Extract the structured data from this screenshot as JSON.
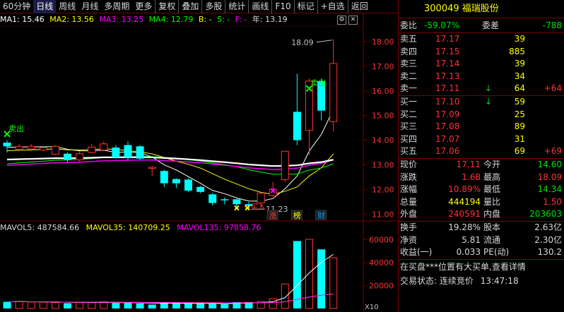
{
  "toolbar": {
    "periods": [
      "60分钟",
      "日线",
      "周线",
      "月线",
      "多周期",
      "更多"
    ],
    "active_period": "日线",
    "actions": [
      "复权",
      "叠加",
      "多股",
      "统计",
      "画线",
      "F10",
      "标记",
      "+自选",
      "返回"
    ]
  },
  "ma_legend": {
    "ma1": "MA1: 15.46",
    "ma2": "MA2: 13.56",
    "ma3": "MA3: 13.25",
    "ma4": "MA4: 12.79",
    "b": "B: -",
    "s": "S: -",
    "f": "F: -",
    "year": "年: 13.19"
  },
  "colors": {
    "up": "#ff3232",
    "down": "#00ffff",
    "ma1": "#ffffff",
    "ma2": "#ffff00",
    "ma3": "#ff00ff",
    "ma4": "#00ff00",
    "grid": "#7a0000",
    "panel_red": "#ff3232",
    "panel_green": "#00e000",
    "panel_yellow": "#ffff00"
  },
  "chart_data": {
    "type": "candlestick",
    "y_axis_labels": [
      "18.00",
      "17.00",
      "16.00",
      "15.00",
      "14.00",
      "13.00",
      "12.00",
      "11.00"
    ],
    "ylim": [
      10.75,
      18.6
    ],
    "annotations": {
      "high": "18.09",
      "low": "11.23",
      "sell_label": "卖出",
      "buy_label": "买入",
      "badges": [
        "涨",
        "榜",
        "财"
      ]
    },
    "candles": [
      {
        "o": 13.9,
        "c": 13.75,
        "h": 14.0,
        "l": 13.5
      },
      {
        "o": 13.62,
        "c": 13.74,
        "h": 13.85,
        "l": 13.55
      },
      {
        "o": 13.64,
        "c": 13.75,
        "h": 13.85,
        "l": 13.55
      },
      {
        "o": 13.6,
        "c": 13.7,
        "h": 13.78,
        "l": 13.55
      },
      {
        "o": 13.43,
        "c": 13.75,
        "h": 13.8,
        "l": 13.4
      },
      {
        "o": 13.45,
        "c": 13.2,
        "h": 13.5,
        "l": 13.1
      },
      {
        "o": 13.2,
        "c": 13.45,
        "h": 13.55,
        "l": 13.15
      },
      {
        "o": 13.5,
        "c": 13.72,
        "h": 13.85,
        "l": 13.45
      },
      {
        "o": 13.6,
        "c": 13.85,
        "h": 13.95,
        "l": 13.55
      },
      {
        "o": 13.7,
        "c": 13.3,
        "h": 13.8,
        "l": 13.25
      },
      {
        "o": 13.8,
        "c": 13.3,
        "h": 13.95,
        "l": 13.2
      },
      {
        "o": 13.75,
        "c": 13.25,
        "h": 13.8,
        "l": 13.2
      },
      {
        "o": 12.85,
        "c": 12.9,
        "h": 12.95,
        "l": 12.55
      },
      {
        "o": 12.75,
        "c": 12.25,
        "h": 12.8,
        "l": 12.1
      },
      {
        "o": 12.42,
        "c": 12.25,
        "h": 12.45,
        "l": 12.05
      },
      {
        "o": 12.4,
        "c": 11.95,
        "h": 12.45,
        "l": 11.9
      },
      {
        "o": 12.1,
        "c": 11.9,
        "h": 12.15,
        "l": 11.85
      },
      {
        "o": 11.8,
        "c": 11.45,
        "h": 11.85,
        "l": 11.35
      },
      {
        "o": 11.6,
        "c": 11.58,
        "h": 11.68,
        "l": 11.4
      },
      {
        "o": 11.6,
        "c": 11.4,
        "h": 11.62,
        "l": 11.3
      },
      {
        "o": 11.4,
        "c": 11.33,
        "h": 11.5,
        "l": 11.23
      },
      {
        "o": 11.45,
        "c": 11.85,
        "h": 11.9,
        "l": 11.3
      },
      {
        "o": 11.75,
        "c": 12.0,
        "h": 12.3,
        "l": 11.7
      },
      {
        "o": 12.4,
        "c": 13.55,
        "h": 13.55,
        "l": 12.3
      },
      {
        "o": 15.15,
        "c": 14.0,
        "h": 16.7,
        "l": 13.8
      },
      {
        "o": 14.4,
        "c": 16.4,
        "h": 16.5,
        "l": 13.4
      },
      {
        "o": 16.4,
        "c": 15.2,
        "h": 16.5,
        "l": 14.8
      },
      {
        "o": 14.75,
        "c": 17.11,
        "h": 18.09,
        "l": 14.35
      }
    ],
    "volume": {
      "y_axis_labels": [
        "60000",
        "40000",
        "20000"
      ],
      "ylim": [
        0,
        64000
      ],
      "x10_label": "X10",
      "values": [
        5800,
        6200,
        5600,
        5600,
        5200,
        4600,
        5400,
        5200,
        5800,
        4800,
        4900,
        4400,
        3400,
        5600,
        4300,
        4300,
        4400,
        4200,
        3700,
        5600,
        5600,
        6200,
        8400,
        21400,
        58800,
        60300,
        51500,
        44200
      ],
      "colors": [
        "d",
        "u",
        "u",
        "u",
        "u",
        "d",
        "u",
        "u",
        "u",
        "d",
        "d",
        "d",
        "d",
        "d",
        "d",
        "d",
        "d",
        "d",
        "d",
        "d",
        "d",
        "u",
        "u",
        "u",
        "d",
        "u",
        "d",
        "u"
      ]
    }
  },
  "vol_legend": {
    "mavol5": "MAVOL5: 487584.66",
    "mavol35": "MAVOL35: 140709.25",
    "mavol135": "MAVOL135: 97858.76"
  },
  "quote": {
    "code": "300049",
    "name": "福瑞股份",
    "weibi_label": "委比",
    "weibi_value": "-59.07%",
    "weicha_label": "委差",
    "weicha_value": "-788",
    "asks": [
      {
        "label": "卖五",
        "price": "17.17",
        "vol": "39",
        "chg": ""
      },
      {
        "label": "卖四",
        "price": "17.15",
        "vol": "885",
        "chg": ""
      },
      {
        "label": "卖三",
        "price": "17.14",
        "vol": "39",
        "chg": ""
      },
      {
        "label": "卖二",
        "price": "17.13",
        "vol": "34",
        "chg": ""
      },
      {
        "label": "卖一",
        "price": "17.11",
        "vol": "64",
        "chg": "+64",
        "arrow": "↓"
      }
    ],
    "bids": [
      {
        "label": "买一",
        "price": "17.10",
        "vol": "59",
        "chg": "",
        "arrow": "↓"
      },
      {
        "label": "买二",
        "price": "17.09",
        "vol": "25",
        "chg": ""
      },
      {
        "label": "买三",
        "price": "17.08",
        "vol": "89",
        "chg": ""
      },
      {
        "label": "买四",
        "price": "17.07",
        "vol": "31",
        "chg": ""
      },
      {
        "label": "买五",
        "price": "17.06",
        "vol": "69",
        "chg": "+69"
      }
    ],
    "stats": [
      {
        "l1": "现价",
        "v1": "17.11",
        "c1": "hl",
        "l2": "今开",
        "v2": "14.60",
        "c2": "gr"
      },
      {
        "l1": "涨跌",
        "v1": "1.68",
        "c1": "hl",
        "l2": "最高",
        "v2": "18.09",
        "c2": "hl"
      },
      {
        "l1": "涨幅",
        "v1": "10.89%",
        "c1": "hl",
        "l2": "最低",
        "v2": "14.34",
        "c2": "gr"
      },
      {
        "l1": "总量",
        "v1": "444194",
        "c1": "yl",
        "l2": "量比",
        "v2": "1.50",
        "c2": "hl"
      },
      {
        "l1": "外盘",
        "v1": "240591",
        "c1": "hl",
        "l2": "内盘",
        "v2": "203603",
        "c2": "gr"
      }
    ],
    "stats2": [
      {
        "l1": "换手",
        "v1": "19.28%",
        "l2": "股本",
        "v2": "2.63亿"
      },
      {
        "l1": "净资",
        "v1": "5.81",
        "l2": "流通",
        "v2": "2.30亿"
      },
      {
        "l1": "收益(一)",
        "v1": "0.033",
        "l2": "PE(动)",
        "v2": "130.2"
      }
    ],
    "message": "在买盘***位置有大买单,查看详情",
    "status_label": "交易状态:",
    "status_value": "连续竞价",
    "time": "13:47:18"
  }
}
